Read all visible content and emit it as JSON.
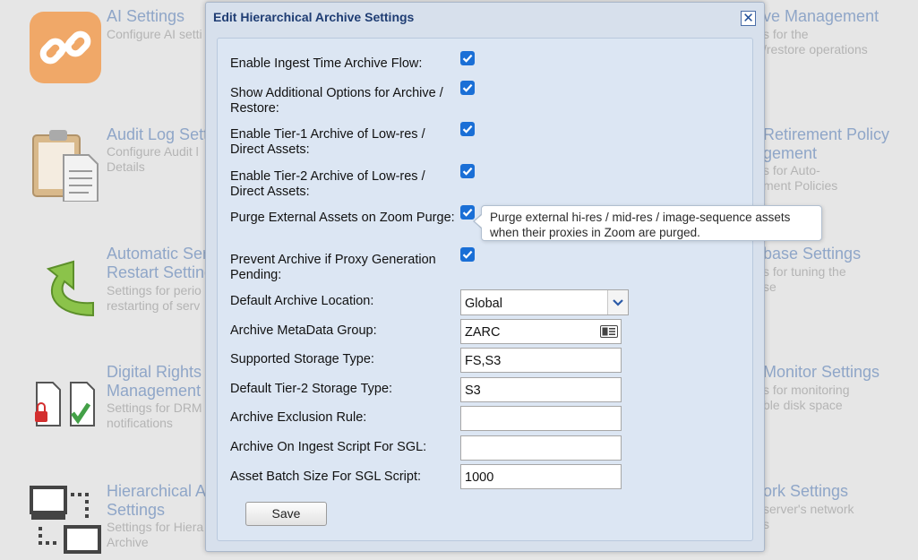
{
  "background": {
    "left_tiles": [
      {
        "title": "AI Settings",
        "desc": "Configure AI setti",
        "icon": "link-chain-icon"
      },
      {
        "title": "Audit Log Setti",
        "desc": "Configure Audit l\nDetails",
        "icon": "clipboard-document-icon"
      },
      {
        "title": "Automatic Ser\nRestart Setting",
        "desc": "Settings for perio\nrestarting of serv",
        "icon": "green-restart-arrow-icon"
      },
      {
        "title": "Digital Rights\nManagement",
        "desc": "Settings for DRM\nnotifications",
        "icon": "locked-approved-documents-icon"
      },
      {
        "title": "Hierarchical A\nSettings",
        "desc": "Settings for Hiera\nArchive",
        "icon": "hierarchy-monitors-icon"
      }
    ],
    "right_tiles": [
      {
        "title": "ve Management",
        "desc": "s for the\n/restore operations"
      },
      {
        "title": "Retirement Policy\ngement",
        "desc": "s for Auto-\nment Policies"
      },
      {
        "title": "base Settings",
        "desc": "s for tuning the\nse"
      },
      {
        "title": "Monitor Settings",
        "desc": "s for monitoring\nble disk space"
      },
      {
        "title": "ork Settings",
        "desc": "server's network\ns"
      }
    ]
  },
  "dialog": {
    "title": "Edit Hierarchical Archive Settings",
    "close_symbol": "✕",
    "checkboxes": [
      {
        "label": "Enable Ingest Time Archive Flow:",
        "checked": true
      },
      {
        "label": "Show Additional Options for Archive / Restore:",
        "checked": true
      },
      {
        "label": "Enable Tier-1 Archive of Low-res / Direct Assets:",
        "checked": true
      },
      {
        "label": "Enable Tier-2 Archive of Low-res / Direct Assets:",
        "checked": true
      },
      {
        "label": "Purge External Assets on Zoom Purge:",
        "checked": true
      },
      {
        "label": "Prevent Archive if Proxy Generation Pending:",
        "checked": true
      }
    ],
    "tooltip": "Purge external hi-res / mid-res / image-sequence assets when their proxies in Zoom are purged.",
    "fields": {
      "default_archive_location": {
        "label": "Default Archive Location:",
        "value": "Global"
      },
      "archive_metadata_group": {
        "label": "Archive MetaData Group:",
        "value": "ZARC"
      },
      "supported_storage_type": {
        "label": "Supported Storage Type:",
        "value": "FS,S3"
      },
      "default_tier2_storage_type": {
        "label": "Default Tier-2 Storage Type:",
        "value": "S3"
      },
      "archive_exclusion_rule": {
        "label": "Archive Exclusion Rule:",
        "value": ""
      },
      "archive_on_ingest_script": {
        "label": "Archive On Ingest Script For SGL:",
        "value": ""
      },
      "asset_batch_size": {
        "label": "Asset Batch Size For SGL Script:",
        "value": "1000"
      }
    },
    "save_label": "Save"
  },
  "colors": {
    "checkbox": "#1a6fd6",
    "dialog_bg": "#d7e0ec",
    "panel_bg": "#dce6f3",
    "title_text": "#1f3d73",
    "bg_title_text": "#8fa6c8"
  }
}
